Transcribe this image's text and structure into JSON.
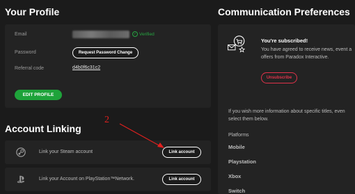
{
  "profile": {
    "title": "Your Profile",
    "email_label": "Email",
    "email_status": "Verified",
    "password_label": "Password",
    "password_button": "Request Password Change",
    "referral_label": "Referral code",
    "referral_code": "d4b0f6c31c2",
    "edit_button": "EDIT PROFILE"
  },
  "account_linking": {
    "title": "Account Linking",
    "rows": [
      {
        "text": "Link your Steam account",
        "button": "Link account",
        "icon": "steam-icon"
      },
      {
        "text": "Link your Account on PlayStation™Network.",
        "button": "Link account",
        "icon": "playstation-icon"
      }
    ]
  },
  "communication": {
    "title": "Communication Preferences",
    "subscribed_title": "You're subscribed!",
    "subscribed_line1": "You have agreed to receive news, event a",
    "subscribed_line2": "offers from Paradox Interactive.",
    "unsubscribe_button": "Unsubscribe",
    "info_line1": "If you wish more information about specific titles, even",
    "info_line2": "select them below.",
    "platforms_label": "Platforms",
    "platforms": [
      "Mobile",
      "Playstation",
      "Xbox",
      "Switch"
    ]
  },
  "annotation": {
    "number": "2",
    "color": "#e0201e"
  },
  "colors": {
    "background": "#1b1b1b",
    "card": "#232323",
    "accent_green": "#1ea33a",
    "danger_red": "#e0324a"
  }
}
